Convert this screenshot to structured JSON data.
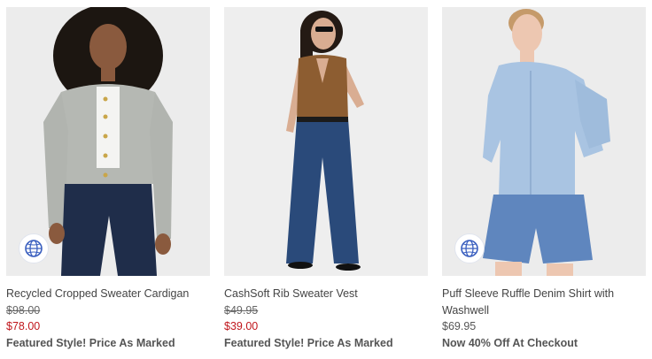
{
  "products": [
    {
      "name": "Recycled Cropped Sweater Cardigan",
      "original_price": "$98.00",
      "sale_price": "$78.00",
      "promo": "Featured Style! Price As Marked",
      "badge_icon": "recycle-globe-icon"
    },
    {
      "name": "CashSoft Rib Sweater Vest",
      "original_price": "$49.95",
      "sale_price": "$39.00",
      "promo": "Featured Style! Price As Marked"
    },
    {
      "name_line1": "Puff Sleeve Ruffle Denim Shirt with",
      "name_line2": "Washwell",
      "price": "$69.95",
      "promo": "Now 40% Off At Checkout",
      "badge_icon": "recycle-globe-icon"
    }
  ],
  "colors": {
    "sale_price": "#c0161c",
    "eco_badge": "#3a5fbf",
    "photo_background": "#ededed"
  }
}
